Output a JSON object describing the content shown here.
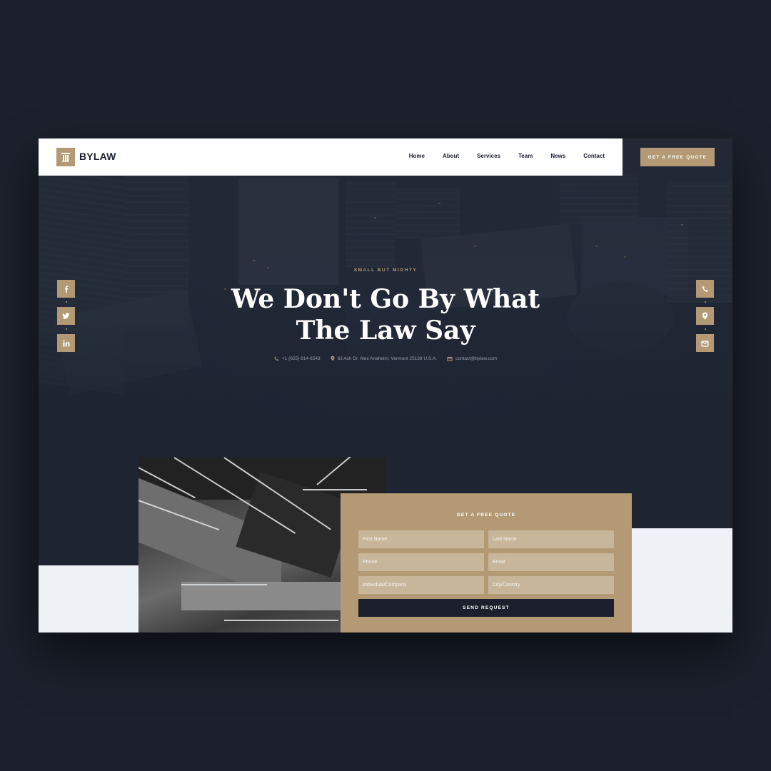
{
  "brand": {
    "name": "BYLAW",
    "logo_icon": "pillar-icon"
  },
  "nav": {
    "items": [
      "Home",
      "About",
      "Services",
      "Team",
      "News",
      "Contact"
    ],
    "cta_label": "GET A FREE QUOTE"
  },
  "hero": {
    "kicker": "SMALL BUT MIGHTY",
    "title_line1": "We Don't Go By What",
    "title_line2": "The Law Say",
    "phone": "+1 (655) 814-6543",
    "address": "63 Ash Dr. Alex Anaheim, Vermont 25138 U.S.A.",
    "email": "contact@bylaw.com"
  },
  "social_icons": [
    "facebook-icon",
    "twitter-icon",
    "linkedin-icon"
  ],
  "contact_icons": [
    "phone-icon",
    "location-icon",
    "mail-icon"
  ],
  "quote_form": {
    "title": "GET A FREE QUOTE",
    "first_name_placeholder": "First Name",
    "last_name_placeholder": "Last Name",
    "phone_placeholder": "Phone",
    "email_placeholder": "Email",
    "company_placeholder": "Individual/Company",
    "city_placeholder": "City/Country",
    "submit_label": "SEND REQUEST"
  },
  "colors": {
    "accent": "#b39a74",
    "dark": "#1b202c",
    "light": "#eef2f6"
  }
}
